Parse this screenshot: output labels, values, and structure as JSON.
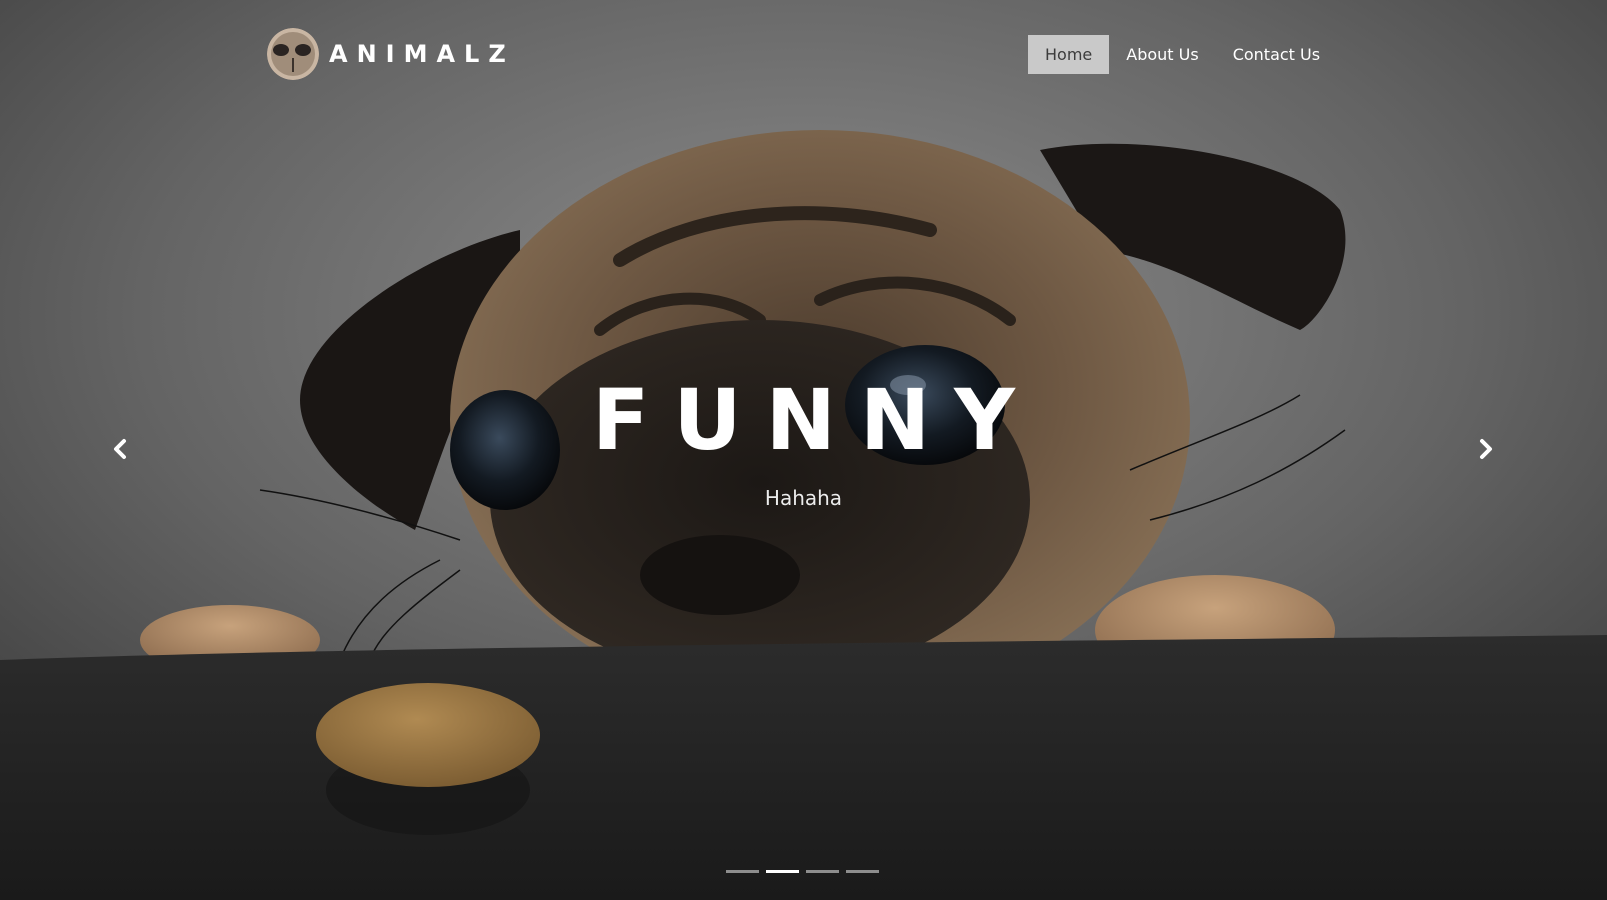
{
  "brand": {
    "name": "ANIMALZ",
    "logo_icon": "dog-nose-icon"
  },
  "nav": {
    "items": [
      {
        "label": "Home",
        "active": true
      },
      {
        "label": "About Us",
        "active": false
      },
      {
        "label": "Contact Us",
        "active": false
      }
    ]
  },
  "slide": {
    "title": "FUNNY",
    "subtitle": "Hahaha",
    "image_subject": "pug-peeking-over-table-at-biscuit"
  },
  "carousel": {
    "prev_icon": "chevron-left-icon",
    "next_icon": "chevron-right-icon",
    "indicator_count": 4,
    "active_indicator": 2
  },
  "colors": {
    "active_nav_bg": "#c9c9c9",
    "active_nav_text": "#3c3c3c",
    "text": "#ffffff"
  }
}
